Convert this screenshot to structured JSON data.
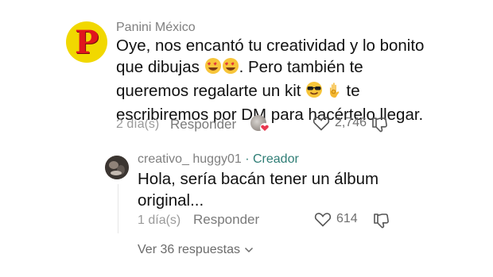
{
  "comment": {
    "author": "Panini México",
    "avatar_letter": "P",
    "lines": [
      "Oye, nos encantó tu creatividad y lo bonito",
      "que dibujas ",
      ". Pero también te",
      "queremos regalarte un kit ",
      " te",
      "escribiremos por DM para hacértelo llegar."
    ],
    "time": "2 día(s)",
    "reply_label": "Responder",
    "likes": "2,746",
    "accent_heart": "#e8374f"
  },
  "reply": {
    "author": "creativo_ huggy01",
    "separator": " · ",
    "badge": "Creador",
    "lines": [
      "Hola, sería bacán tener un álbum",
      "original..."
    ],
    "time": "1 día(s)",
    "reply_label": "Responder",
    "likes": "614"
  },
  "view_replies": "Ver 36 respuestas",
  "colors": {
    "brand_yellow": "#f1d800",
    "brand_red": "#e0161d",
    "creator": "#2e7d75"
  }
}
